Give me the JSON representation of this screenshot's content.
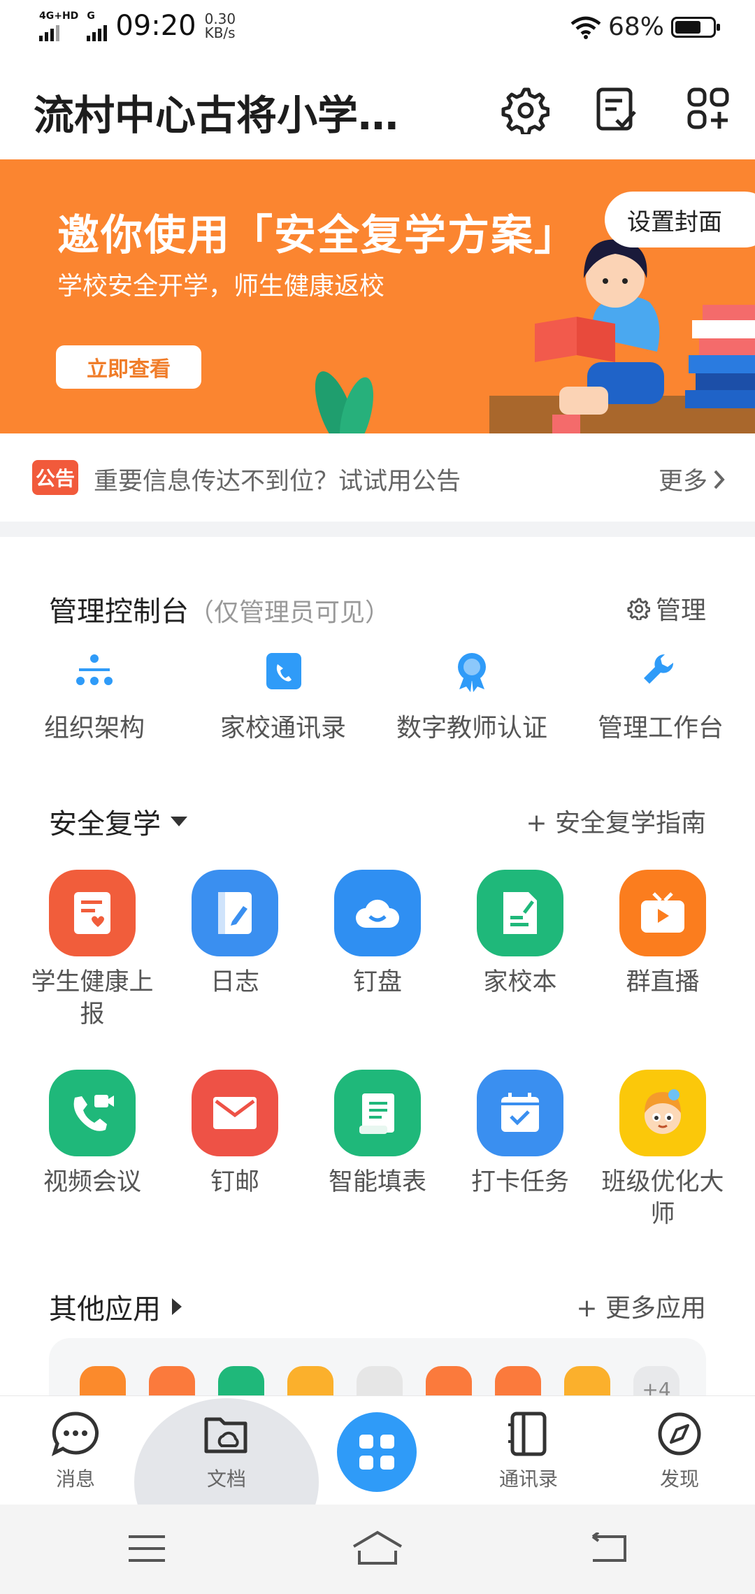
{
  "status_bar": {
    "network_label": "4G+HD",
    "network_label2": "G",
    "time": "09:20",
    "speed_value": "0.30",
    "speed_unit": "KB/s",
    "battery": "68%",
    "battery_level": 0.68
  },
  "header": {
    "title": "流村中心古将小学…",
    "icons": [
      "settings-icon",
      "checklist-icon",
      "add-app-icon"
    ]
  },
  "banner": {
    "title": "邀你使用「安全复学方案」",
    "subtitle": "学校安全开学，师生健康返校",
    "button": "立即查看",
    "set_cover": "设置封面",
    "color": "#fb8530"
  },
  "notice": {
    "badge": "公告",
    "text": "重要信息传达不到位？试试用公告",
    "more": "更多"
  },
  "admin": {
    "title": "管理控制台",
    "subtitle": "（仅管理员可见）",
    "manage": "管理",
    "items": [
      {
        "label": "组织架构",
        "icon": "org-chart-icon"
      },
      {
        "label": "家校通讯录",
        "icon": "contacts-book-icon"
      },
      {
        "label": "数字教师认证",
        "icon": "award-badge-icon"
      },
      {
        "label": "管理工作台",
        "icon": "wrench-icon"
      }
    ]
  },
  "safe_return": {
    "title": "安全复学",
    "guide": "+ 安全复学指南",
    "apps": [
      {
        "label": "学生健康上报",
        "icon": "health-report-icon",
        "color": "#f15d3b"
      },
      {
        "label": "日志",
        "icon": "journal-icon",
        "color": "#3a8ff0"
      },
      {
        "label": "钉盘",
        "icon": "cloud-drive-icon",
        "color": "#2f8ff2"
      },
      {
        "label": "家校本",
        "icon": "notebook-icon",
        "color": "#1fb87a"
      },
      {
        "label": "群直播",
        "icon": "live-tv-icon",
        "color": "#fb7d1e"
      },
      {
        "label": "视频会议",
        "icon": "video-call-icon",
        "color": "#1fb87a"
      },
      {
        "label": "钉邮",
        "icon": "mail-icon",
        "color": "#ee5246"
      },
      {
        "label": "智能填表",
        "icon": "form-icon",
        "color": "#1fb87a"
      },
      {
        "label": "打卡任务",
        "icon": "calendar-check-icon",
        "color": "#3a8ff0"
      },
      {
        "label": "班级优化大师",
        "icon": "mascot-icon",
        "color": "#fbc80a"
      }
    ]
  },
  "other_apps": {
    "title": "其他应用",
    "more": "+ 更多应用",
    "extra_count": "+4",
    "mini_colors": [
      "#fb8a2c",
      "#fb7a3c",
      "#1fb87a",
      "#fbb02c",
      "#eeeeee",
      "#fb7a3c",
      "#fb7a3c",
      "#fbb02c"
    ]
  },
  "bottom_nav": {
    "items": [
      {
        "label": "消息",
        "icon": "chat-bubble-icon"
      },
      {
        "label": "文档",
        "icon": "folder-cloud-icon"
      },
      {
        "label": "",
        "icon": "workbench-grid-icon"
      },
      {
        "label": "通讯录",
        "icon": "address-book-icon"
      },
      {
        "label": "发现",
        "icon": "compass-icon"
      }
    ]
  }
}
